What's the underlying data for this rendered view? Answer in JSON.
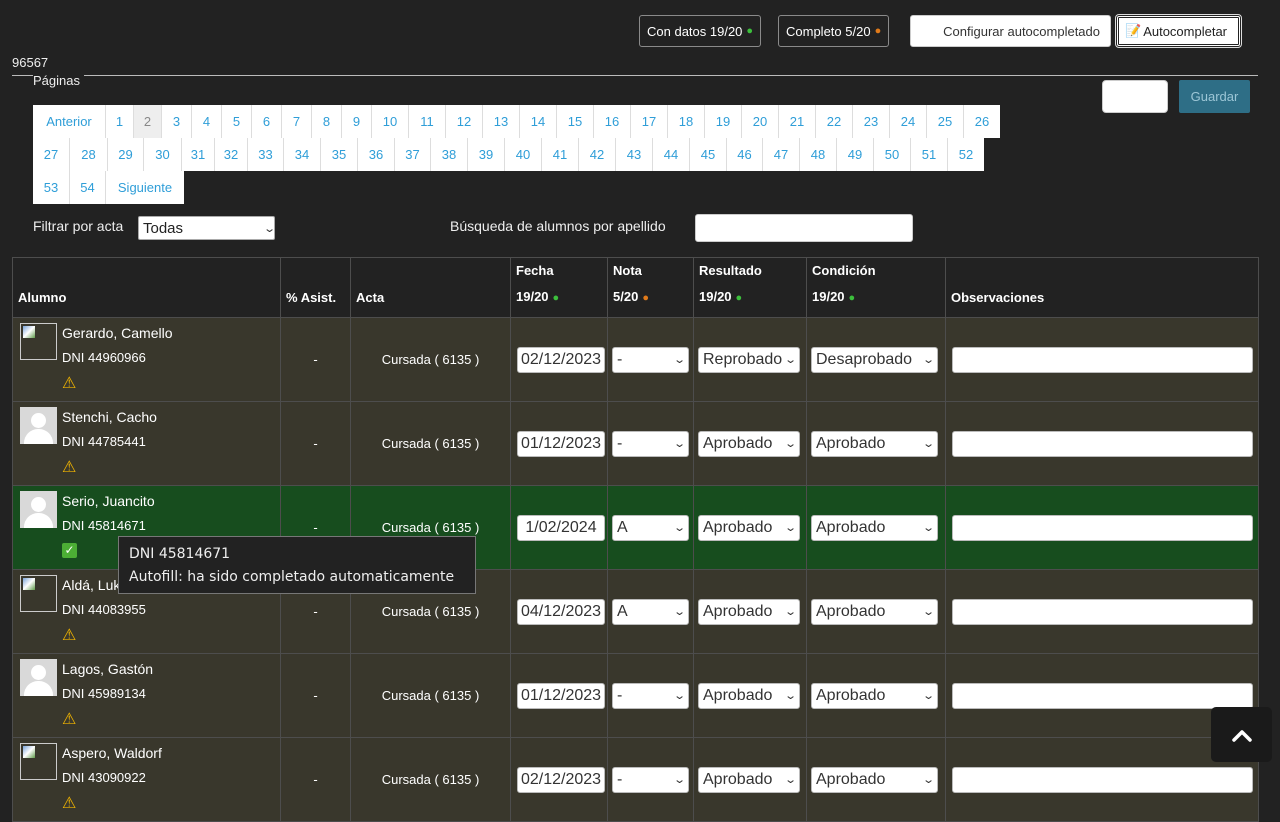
{
  "toolbar": {
    "con_datos": "Con datos 19/20",
    "completo": "Completo 5/20",
    "configurar": "Configurar autocompletado",
    "autocompletar": "Autocompletar",
    "autocompletar_icon": "memo-icon"
  },
  "page_id": "96567",
  "paginas_label": "Páginas",
  "guardar_label": "Guardar",
  "pagination": {
    "rows": [
      [
        "Anterior",
        "1",
        "2",
        "3",
        "4",
        "5",
        "6",
        "7",
        "8",
        "9",
        "10",
        "11",
        "12",
        "13",
        "14",
        "15",
        "16",
        "17",
        "18",
        "19",
        "20",
        "21",
        "22",
        "23",
        "24",
        "25",
        "26"
      ],
      [
        "27",
        "28",
        "29",
        "30",
        "31",
        "32",
        "33",
        "34",
        "35",
        "36",
        "37",
        "38",
        "39",
        "40",
        "41",
        "42",
        "43",
        "44",
        "45",
        "46",
        "47",
        "48",
        "49",
        "50",
        "51",
        "52"
      ],
      [
        "53",
        "54",
        "Siguiente"
      ]
    ],
    "active": "2"
  },
  "filter": {
    "label": "Filtrar por acta",
    "value": "Todas"
  },
  "search": {
    "label": "Búsqueda de alumnos por apellido",
    "value": ""
  },
  "table": {
    "headers": {
      "alumno": "Alumno",
      "asist": "% Asist.",
      "acta": "Acta",
      "fecha": "Fecha",
      "fecha_count": "19/20",
      "nota": "Nota",
      "nota_count": "5/20",
      "resultado": "Resultado",
      "resultado_count": "19/20",
      "condicion": "Condición",
      "condicion_count": "19/20",
      "observaciones": "Observaciones"
    },
    "rows": [
      {
        "name": "Gerardo, Camello",
        "dni": "DNI 44960966",
        "avatar": "broken",
        "status": "warning",
        "asist": "-",
        "acta": "Cursada ( 6135 )",
        "fecha": "02/12/2023",
        "nota": "-",
        "resultado": "Reprobado",
        "condicion": "Desaprobado",
        "obs": "",
        "highlight": false
      },
      {
        "name": "Stenchi, Cacho",
        "dni": "DNI 44785441",
        "avatar": "photo",
        "status": "warning",
        "asist": "-",
        "acta": "Cursada ( 6135 )",
        "fecha": "01/12/2023",
        "nota": "-",
        "resultado": "Aprobado",
        "condicion": "Aprobado",
        "obs": "",
        "highlight": false
      },
      {
        "name": "Serio, Juancito",
        "dni": "DNI 45814671",
        "avatar": "photo",
        "status": "ok",
        "asist": "-",
        "acta": "Cursada ( 6135 )",
        "fecha": "1/02/2024",
        "nota": "A",
        "resultado": "Aprobado",
        "condicion": "Aprobado",
        "obs": "",
        "highlight": true
      },
      {
        "name": "Aldá, Luk",
        "dni": "DNI 44083955",
        "avatar": "broken",
        "status": "warning",
        "asist": "-",
        "acta": "Cursada ( 6135 )",
        "fecha": "04/12/2023",
        "nota": "A",
        "resultado": "Aprobado",
        "condicion": "Aprobado",
        "obs": "",
        "highlight": false
      },
      {
        "name": "Lagos, Gastón",
        "dni": "DNI 45989134",
        "avatar": "photo",
        "status": "warning",
        "asist": "-",
        "acta": "Cursada ( 6135 )",
        "fecha": "01/12/2023",
        "nota": "-",
        "resultado": "Aprobado",
        "condicion": "Aprobado",
        "obs": "",
        "highlight": false
      },
      {
        "name": "Aspero, Waldorf",
        "dni": "DNI 43090922",
        "avatar": "broken",
        "status": "warning",
        "asist": "-",
        "acta": "Cursada ( 6135 )",
        "fecha": "02/12/2023",
        "nota": "-",
        "resultado": "Aprobado",
        "condicion": "Aprobado",
        "obs": "",
        "highlight": false
      }
    ]
  },
  "tooltip": {
    "line1": "DNI 45814671",
    "line2": "Autofill: ha sido completado automaticamente"
  },
  "colors": {
    "accent": "#2f9ed8",
    "guardar": "#2e6e86",
    "dot_green": "#3cbf3c",
    "dot_orange": "#e07a1a",
    "row": "#39372c",
    "row_highlight": "#174d1e"
  },
  "icons": {
    "warning": "warning-icon",
    "ok": "check-mark-icon",
    "scroll_top": "chevron-up-icon"
  }
}
